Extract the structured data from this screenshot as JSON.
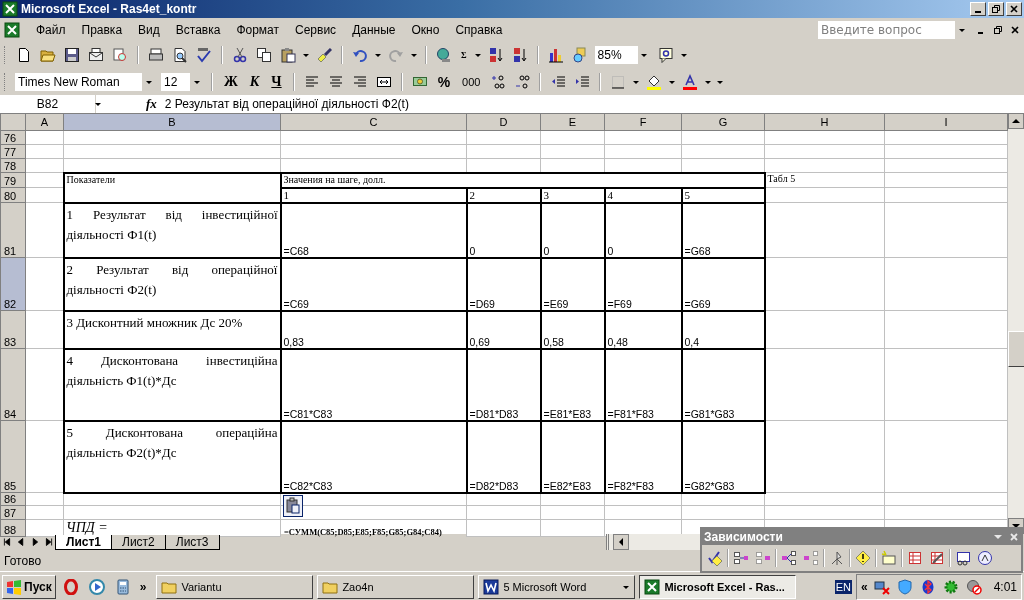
{
  "window": {
    "title": "Microsoft Excel - Ras4et_kontr"
  },
  "menu": [
    "Файл",
    "Правка",
    "Вид",
    "Вставка",
    "Формат",
    "Сервис",
    "Данные",
    "Окно",
    "Справка"
  ],
  "help_search": {
    "placeholder": "Введите вопрос"
  },
  "standard_toolbar": {
    "sum": "Σ",
    "zoom": "85%",
    "redo_disabled": true
  },
  "formatting_toolbar": {
    "font": "Times New Roman",
    "size": "12",
    "bold": "Ж",
    "italic": "К",
    "underline": "Ч",
    "percent": "%",
    "thousands": "000"
  },
  "formula_bar": {
    "name_box": "B82",
    "function_label": "fx",
    "formula": "2 Результат від операційної діяльності Ф2(t)"
  },
  "columns": [
    {
      "label": "A",
      "selected": false
    },
    {
      "label": "B",
      "selected": true
    },
    {
      "label": "C",
      "selected": false
    },
    {
      "label": "D",
      "selected": false
    },
    {
      "label": "E",
      "selected": false
    },
    {
      "label": "F",
      "selected": false
    },
    {
      "label": "G",
      "selected": false
    },
    {
      "label": "H",
      "selected": false
    },
    {
      "label": "I",
      "selected": false
    }
  ],
  "rows": [
    {
      "number": "76",
      "selected": false
    },
    {
      "number": "77",
      "selected": false
    },
    {
      "number": "78",
      "selected": false
    },
    {
      "number": "79",
      "selected": false
    },
    {
      "number": "80",
      "selected": false
    },
    {
      "number": "81",
      "selected": false
    },
    {
      "number": "82",
      "selected": true
    },
    {
      "number": "83",
      "selected": false
    },
    {
      "number": "84",
      "selected": false
    },
    {
      "number": "85",
      "selected": false
    },
    {
      "number": "86",
      "selected": false
    },
    {
      "number": "87",
      "selected": false
    },
    {
      "number": "88",
      "selected": false
    }
  ],
  "table": {
    "header_label": "Показатели",
    "values_heading": "Значения на шаге, долл.",
    "note": "Табл 5",
    "steps": [
      "1",
      "2",
      "3",
      "4",
      "5"
    ],
    "indicators": [
      {
        "label": "1 Результат від інвестиційної діяльності Ф1(t)",
        "values": [
          "=C68",
          "0",
          "0",
          "0",
          "=G68"
        ]
      },
      {
        "label": "2 Результат від операційної діяльності Ф2(t)",
        "values": [
          "=C69",
          "=D69",
          "=E69",
          "=F69",
          "=G69"
        ]
      },
      {
        "label": "3 Дисконтний множник Дс 20%",
        "values": [
          "0,83",
          "0,69",
          "0,58",
          "0,48",
          "0,4"
        ]
      },
      {
        "label": "4 Дисконтована інвестиційна діяльність Ф1(t)*Дс",
        "values": [
          "=C81*C83",
          "=D81*D83",
          "=E81*E83",
          "=F81*F83",
          "=G81*G83"
        ]
      },
      {
        "label": "5 Дисконтована операційна діяльність Ф2(t)*Дс",
        "values": [
          "=C82*C83",
          "=D82*D83",
          "=E82*E83",
          "=F82*F83",
          "=G82*G83"
        ]
      }
    ]
  },
  "npv": {
    "label": "ЧПД =",
    "formula": "=СУММ(C85;D85;E85;F85;G85;G84;C84)"
  },
  "sheet_tabs": [
    {
      "label": "Лист1",
      "selected": true
    },
    {
      "label": "Лист2",
      "selected": false
    },
    {
      "label": "Лист3",
      "selected": false
    }
  ],
  "status_bar": "Готово",
  "dependencies_toolbar": {
    "title": "Зависимости"
  },
  "taskbar": {
    "start": "Пуск",
    "more": "»",
    "tasks": [
      {
        "label": "Variantu",
        "kind": "folder",
        "selected": false
      },
      {
        "label": "Zao4n",
        "kind": "folder",
        "selected": false
      },
      {
        "label": "5 Microsoft Word",
        "kind": "word",
        "selected": false
      },
      {
        "label": "Microsoft Excel - Ras...",
        "kind": "excel",
        "selected": true
      }
    ],
    "language": "EN",
    "tray_expand": "«",
    "clock": "4:01"
  }
}
